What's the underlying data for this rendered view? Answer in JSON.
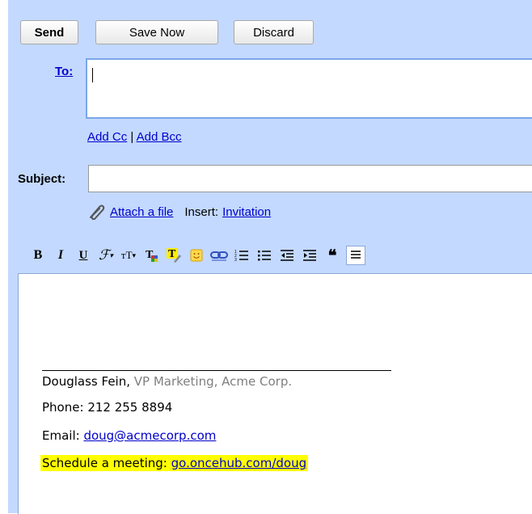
{
  "toolbar": {
    "send_label": "Send",
    "save_label": "Save Now",
    "discard_label": "Discard"
  },
  "to": {
    "label": "To:",
    "value": ""
  },
  "cc_links": {
    "add_cc": "Add Cc",
    "separator": "|",
    "add_bcc": "Add Bcc"
  },
  "subject": {
    "label": "Subject:",
    "value": ""
  },
  "attach": {
    "attach_label": "Attach a file",
    "insert_label": "Insert:",
    "invitation_label": "Invitation"
  },
  "format_toolbar": [
    {
      "name": "bold-icon",
      "glyph": "B"
    },
    {
      "name": "italic-icon",
      "glyph": "I"
    },
    {
      "name": "underline-icon",
      "glyph": "U"
    },
    {
      "name": "font-icon",
      "glyph": "F"
    },
    {
      "name": "text-size-icon",
      "glyph": "TT"
    },
    {
      "name": "text-color-icon",
      "glyph": "T"
    },
    {
      "name": "highlight-icon",
      "glyph": "T"
    },
    {
      "name": "emoticon-icon",
      "glyph": "smile"
    },
    {
      "name": "link-icon",
      "glyph": "link"
    },
    {
      "name": "numbered-list-icon",
      "glyph": "ol"
    },
    {
      "name": "bulleted-list-icon",
      "glyph": "ul"
    },
    {
      "name": "outdent-icon",
      "glyph": "outdent"
    },
    {
      "name": "indent-icon",
      "glyph": "indent"
    },
    {
      "name": "quote-icon",
      "glyph": "quote"
    },
    {
      "name": "align-icon",
      "glyph": "align"
    }
  ],
  "signature": {
    "name": "Douglass Fein,",
    "title": "VP Marketing, Acme Corp.",
    "phone_label": "Phone:",
    "phone": "212 255 8894",
    "email_label": "Email:",
    "email": "doug@acmecorp.com",
    "schedule_label": "Schedule a meeting:",
    "schedule_link": "go.oncehub.com/doug"
  },
  "colors": {
    "panel": "#c3d9ff",
    "link": "#0000cc",
    "highlight": "#ffff00",
    "field_border": "#7aa6e8"
  }
}
